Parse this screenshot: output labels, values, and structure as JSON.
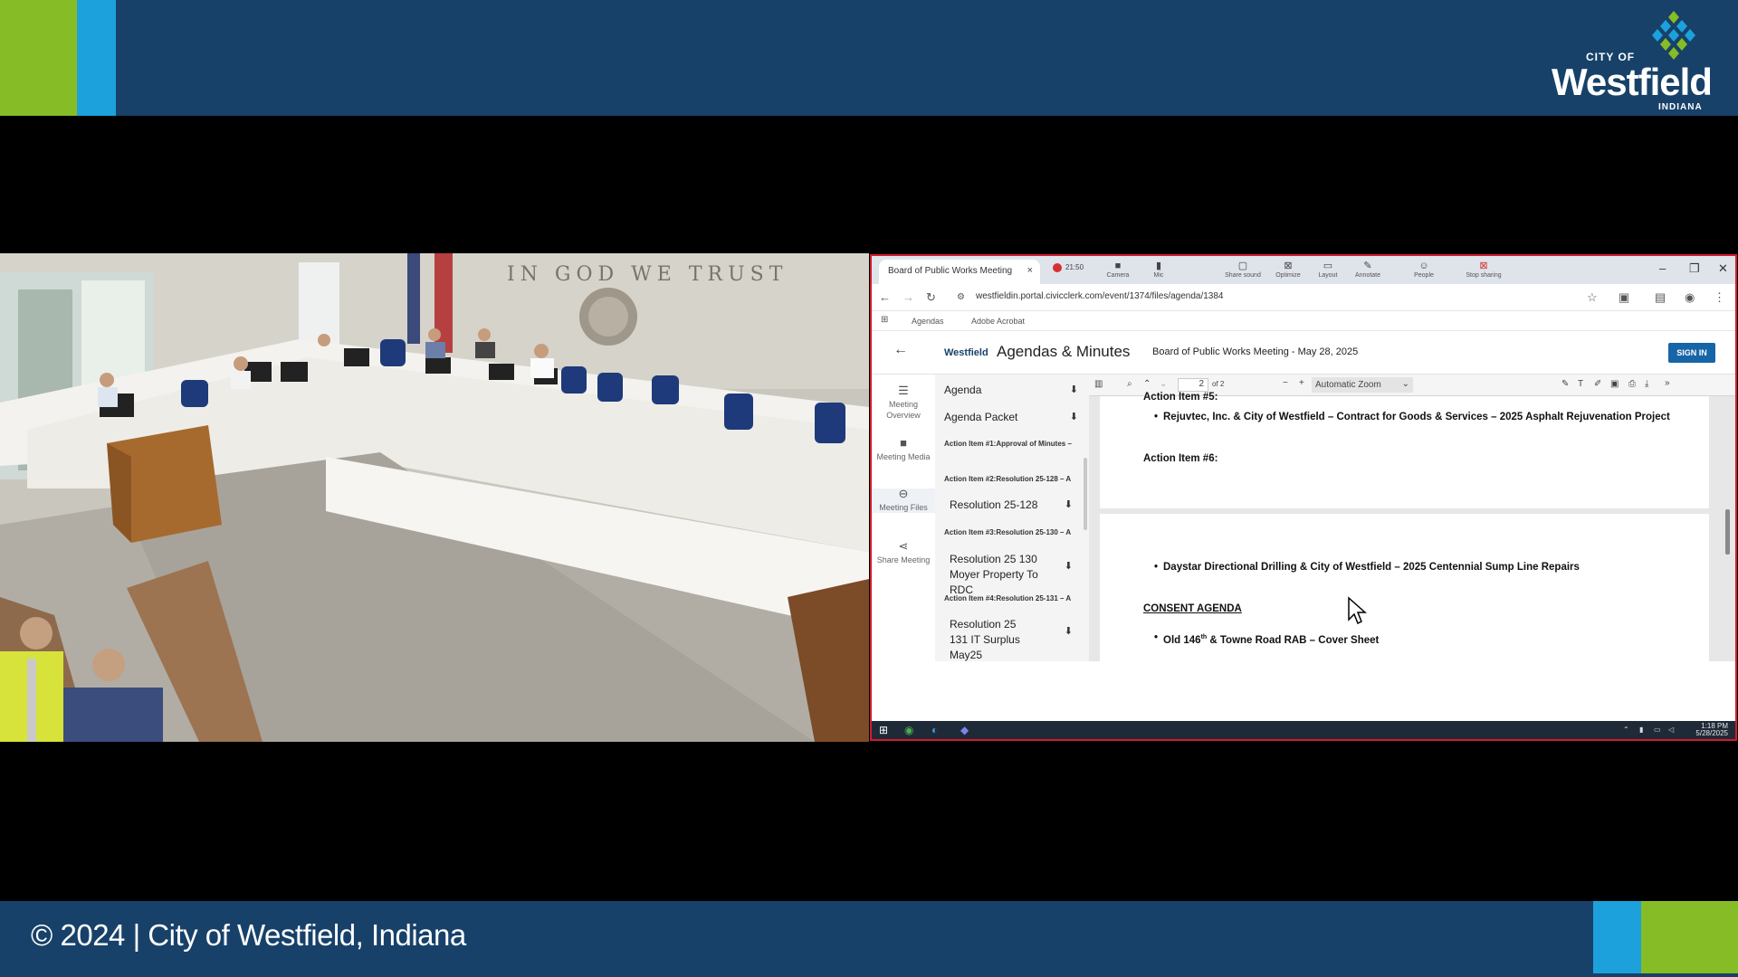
{
  "header": {
    "logo": {
      "city_of": "CITY OF",
      "name": "Westfield",
      "state": "INDIANA"
    },
    "colors": {
      "navy": "#174169",
      "green": "#86bc25",
      "blue": "#1da1dc"
    }
  },
  "footer": {
    "text": "© 2024 | City of Westfield, Indiana"
  },
  "screen_share": {
    "tab": {
      "title": "Board of Public Works Meeting",
      "close": "×"
    },
    "share_toolbar": {
      "timer": "21:50",
      "items": [
        "Camera",
        "Mic",
        "Share sound",
        "Optimize",
        "Layout",
        "Annotate",
        "People",
        "Stop sharing"
      ]
    },
    "window_controls": {
      "minimize": "–",
      "restore": "❐",
      "close": "✕"
    },
    "url": "westfieldin.portal.civicclerk.com/event/1374/files/agenda/1384",
    "bookmarks": [
      "Agendas",
      "Adobe Acrobat"
    ],
    "app": {
      "logo_text": "Westfield",
      "title": "Agendas & Minutes",
      "meeting": "Board of Public Works Meeting - May 28, 2025",
      "signin": "SIGN IN"
    },
    "rail": [
      "Meeting Overview",
      "Meeting Media",
      "Meeting Files",
      "Share Meeting"
    ],
    "files": {
      "agenda": "Agenda",
      "agenda_packet": "Agenda Packet",
      "heads": [
        "Action Item #1:Approval of Minutes –",
        "Action Item #2:Resolution 25-128 – A",
        "Action Item #3:Resolution 25-130 – A",
        "Action Item #4:Resolution 25-131 – A"
      ],
      "resolution_128": "Resolution 25-128",
      "resolution_130": "Resolution 25 130 Moyer Property To RDC",
      "resolution_131": "Resolution 25 131 IT Surplus May25"
    },
    "pdf": {
      "page_number": "2",
      "page_of": "of 2",
      "zoom": "Automatic Zoom",
      "prev_heading": "Action Item #5:",
      "bullet1": "Rejuvtec, Inc. & City of Westfield – Contract for Goods & Services – 2025 Asphalt Rejuvenation Project",
      "action6": "Action Item #6:",
      "bullet2": "Daystar Directional Drilling & City of Westfield – 2025 Centennial Sump Line Repairs",
      "consent": "CONSENT AGENDA",
      "bullet3_a": "Old 146",
      "bullet3_sup": "th",
      "bullet3_b": " & Towne Road RAB – Cover Sheet"
    },
    "taskbar": {
      "time": "1:18 PM",
      "date": "5/28/2025"
    }
  },
  "camera": {
    "wall_text": "IN GOD WE TRUST"
  }
}
